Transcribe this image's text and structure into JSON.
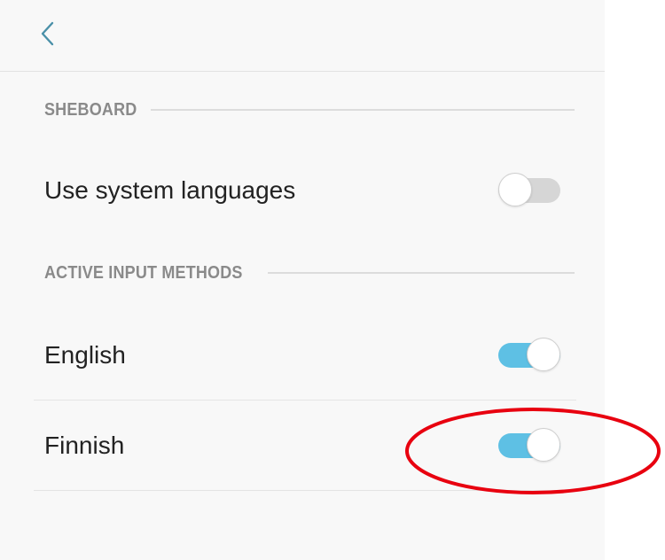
{
  "header": {
    "back_icon": "chevron-left-icon"
  },
  "sections": {
    "sheboard": {
      "title": "SHEBOARD"
    },
    "active_input_methods": {
      "title": "ACTIVE INPUT METHODS"
    }
  },
  "settings": {
    "use_system_languages": {
      "label": "Use system languages",
      "enabled": false
    },
    "english": {
      "label": "English",
      "enabled": true
    },
    "finnish": {
      "label": "Finnish",
      "enabled": true
    }
  },
  "colors": {
    "accent": "#5ec0e4",
    "back_icon": "#4a90a8",
    "highlight": "#e8000f"
  }
}
